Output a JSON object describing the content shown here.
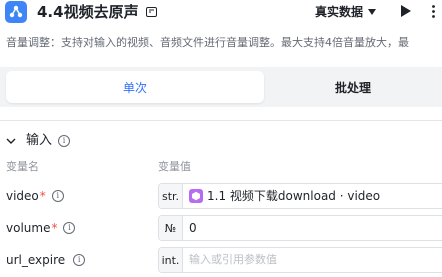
{
  "header": {
    "title": "4.4视频去原声",
    "data_select": "真实数据",
    "app_icon": "workflow-icon",
    "edit_icon": "edit-icon",
    "play_icon": "play-icon",
    "more_icon": "more-icon"
  },
  "description": "音量调整：支持对输入的视频、音频文件进行音量调整。最大支持4倍音量放大，最",
  "tabs": {
    "single": "单次",
    "batch": "批处理",
    "active": "single"
  },
  "input_section": {
    "title": "输入",
    "col_name": "变量名",
    "col_value": "变量值",
    "rows": [
      {
        "name": "video",
        "required": true,
        "type": "str.",
        "value_ref": "1.1 视频下载download · video",
        "placeholder": ""
      },
      {
        "name": "volume",
        "required": true,
        "type": "№",
        "value": "0",
        "placeholder": ""
      },
      {
        "name": "url_expire",
        "required": false,
        "type": "int.",
        "value": "",
        "placeholder": "输入或引用参数值"
      }
    ]
  },
  "colors": {
    "accent": "#3370ff",
    "required": "#f54a45",
    "app_icon": "#3e86f7",
    "ref_icon": "#b76cf2"
  }
}
